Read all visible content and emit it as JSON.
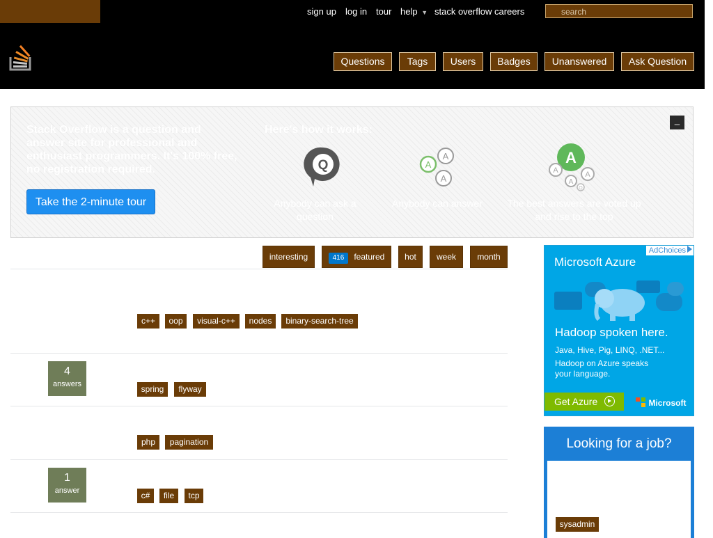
{
  "topbar": {
    "links": [
      "sign up",
      "log in",
      "tour",
      "help",
      "stack overflow careers"
    ],
    "help_arrow": "▼",
    "search_placeholder": "search"
  },
  "nav": [
    "Questions",
    "Tags",
    "Users",
    "Badges",
    "Unanswered",
    "Ask Question"
  ],
  "hero": {
    "intro": "Stack Overflow is a question and answer site for professional and enthusiast programmers. It's 100% free, no registration required.",
    "how_it_works": "Here's how it works:",
    "features": [
      "Anybody can ask a question",
      "Anybody can answer",
      "The best answers are voted up and rise to the top"
    ],
    "tour_button": "Take the 2-minute tour",
    "close": "_",
    "icon_letters": {
      "q": "Q",
      "a": "A"
    }
  },
  "filters": {
    "interesting": "interesting",
    "featured": "featured",
    "featured_count": "416",
    "hot": "hot",
    "week": "week",
    "month": "month"
  },
  "questions": [
    {
      "tags": [
        "c++",
        "oop",
        "visual-c++",
        "nodes",
        "binary-search-tree"
      ]
    },
    {
      "answers": "4",
      "answers_label": "answers",
      "tags": [
        "spring",
        "flyway"
      ]
    },
    {
      "tags": [
        "php",
        "pagination"
      ]
    },
    {
      "answers": "1",
      "answers_label": "answer",
      "tags": [
        "c#",
        "file",
        "tcp"
      ]
    }
  ],
  "ad": {
    "adchoices": "AdChoices",
    "brand": "Microsoft Azure",
    "headline": "Hadoop spoken here.",
    "line1": "Java, Hive, Pig, LINQ, .NET...",
    "line2": "Hadoop on Azure speaks",
    "line3": "your language.",
    "cta": "Get Azure",
    "ms_brand": "Microsoft"
  },
  "job_box": {
    "title": "Looking for a job?",
    "tags": [
      "sysadmin"
    ]
  },
  "colors": {
    "brown": "#6a3c07",
    "black": "#000000",
    "tour_blue": "#1e8ff0",
    "featured_blue": "#0077cc",
    "answers_green": "#6f7d58",
    "ad_blue": "#00a6e6",
    "job_blue": "#1c7fd6",
    "azure_green": "#7fba00"
  }
}
